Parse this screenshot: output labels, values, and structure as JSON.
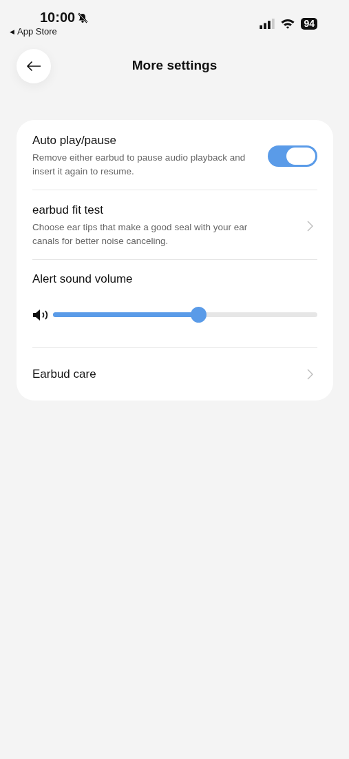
{
  "status_bar": {
    "time": "10:00",
    "back_arrow": "◀",
    "back_label": "App Store",
    "battery": "94"
  },
  "header": {
    "title": "More settings"
  },
  "settings": [
    {
      "kind": "toggle",
      "title": "Auto play/pause",
      "description": "Remove either earbud to pause audio playback and insert it again to resume.",
      "on": true
    },
    {
      "kind": "link",
      "title": "earbud fit test",
      "description": "Choose ear tips that make a good seal with your ear canals for better noise canceling."
    },
    {
      "kind": "slider",
      "title": "Alert sound volume",
      "level": 0.55
    },
    {
      "kind": "link",
      "title": "Earbud care"
    }
  ]
}
